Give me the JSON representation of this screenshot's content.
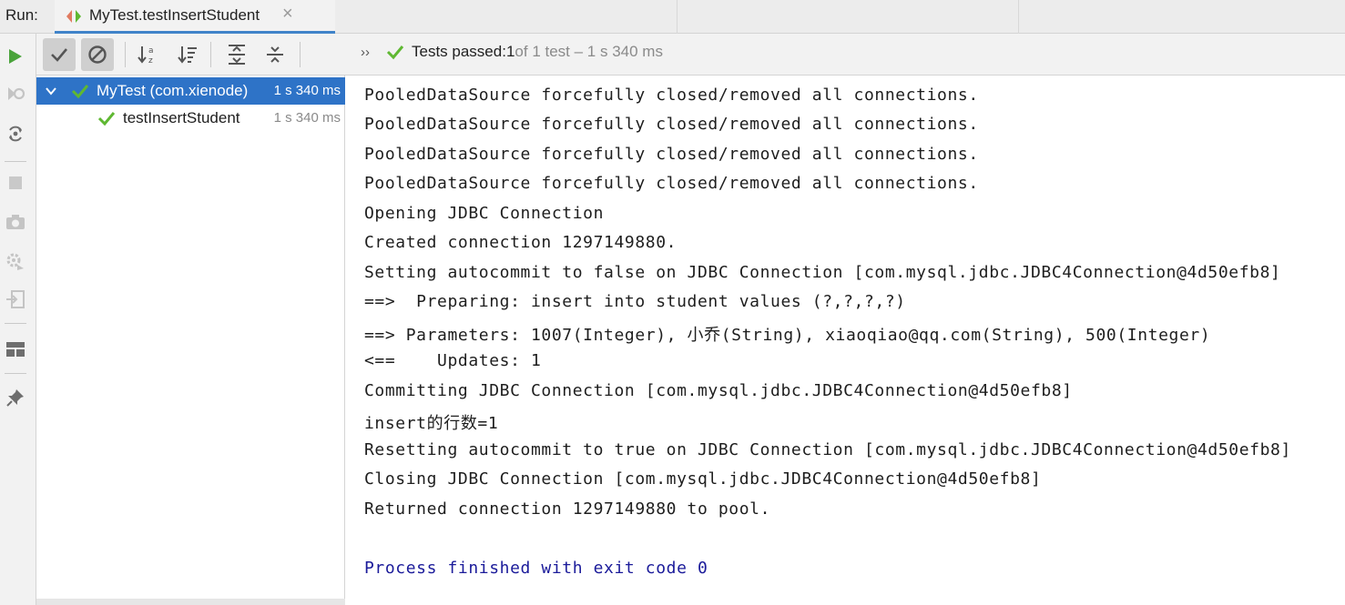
{
  "runbar": {
    "run_label": "Run:",
    "tab_title": "MyTest.testInsertStudent",
    "close_glyph": "×"
  },
  "toolbar": {
    "status_more": "››",
    "status_prefix": "Tests passed: ",
    "status_count": "1",
    "status_suffix": " of 1 test – 1 s 340 ms",
    "icons": [
      "show-passed-icon",
      "show-ignored-icon",
      "sort-alpha-icon",
      "sort-duration-icon",
      "expand-all-icon",
      "collapse-all-icon"
    ]
  },
  "leftstrip": {
    "icons": [
      "run-icon",
      "rerun-failed-icon",
      "toggle-autotest-icon",
      "stop-icon",
      "snapshot-icon",
      "settings-icon",
      "import-icon",
      "layout-icon",
      "pin-icon"
    ]
  },
  "tree": {
    "items": [
      {
        "label": "MyTest (com.xienode)",
        "time": "1 s 340 ms",
        "status": "passed"
      },
      {
        "label": "testInsertStudent",
        "time": "1 s 340 ms",
        "status": "passed"
      }
    ]
  },
  "console": {
    "lines": [
      "PooledDataSource forcefully closed/removed all connections.",
      "PooledDataSource forcefully closed/removed all connections.",
      "PooledDataSource forcefully closed/removed all connections.",
      "PooledDataSource forcefully closed/removed all connections.",
      "Opening JDBC Connection",
      "Created connection 1297149880.",
      "Setting autocommit to false on JDBC Connection [com.mysql.jdbc.JDBC4Connection@4d50efb8]",
      "==>  Preparing: insert into student values (?,?,?,?)",
      "==> Parameters: 1007(Integer), 小乔(String), xiaoqiao@qq.com(String), 500(Integer)",
      "<==    Updates: 1",
      "Committing JDBC Connection [com.mysql.jdbc.JDBC4Connection@4d50efb8]",
      "insert的行数=1",
      "Resetting autocommit to true on JDBC Connection [com.mysql.jdbc.JDBC4Connection@4d50efb8]",
      "Closing JDBC Connection [com.mysql.jdbc.JDBC4Connection@4d50efb8]",
      "Returned connection 1297149880 to pool.",
      "",
      "Process finished with exit code 0"
    ]
  },
  "colors": {
    "pass_green": "#5fb832",
    "selection_blue": "#2e73c7",
    "finish_blue": "#1b1b9a",
    "tab_underline": "#4083c9"
  }
}
